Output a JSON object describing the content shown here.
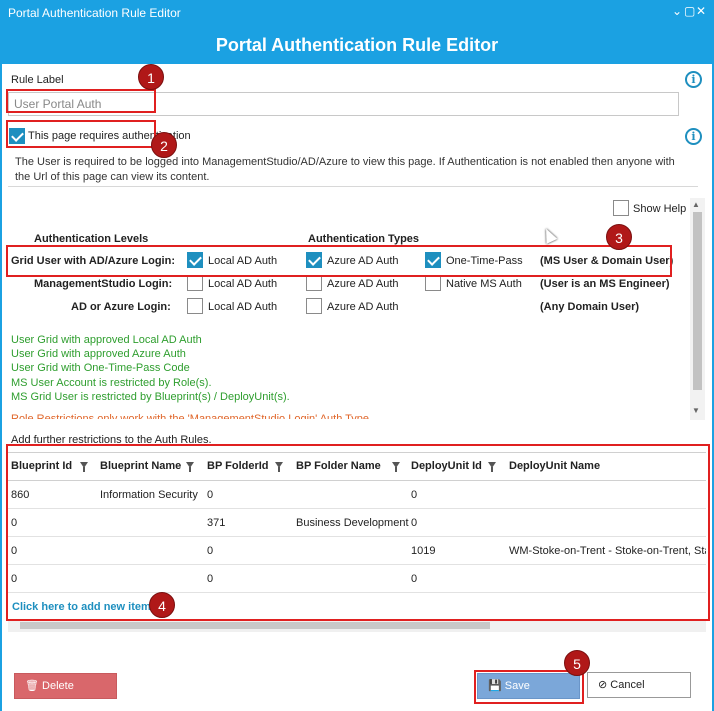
{
  "window": {
    "title": "Portal Authentication Rule Editor",
    "controls": [
      "⌄",
      "▢",
      "✕"
    ]
  },
  "header": {
    "title": "Portal Authentication Rule Editor"
  },
  "rule_label": {
    "label": "Rule Label",
    "value": "User Portal Auth"
  },
  "auth": {
    "checkbox_label": "This page requires authentication",
    "checked": true,
    "description": "The User is required to be logged into ManagementStudio/AD/Azure to view this page. If Authentication is not enabled then anyone with the Url of this page can view its content."
  },
  "show_help": {
    "label": "Show Help",
    "checked": false
  },
  "levels": {
    "heading_levels": "Authentication Levels",
    "heading_types": "Authentication Types",
    "rows": [
      {
        "label": "Grid User with AD/Azure Login:",
        "bold": true,
        "options": [
          {
            "label": "Local AD Auth",
            "checked": true
          },
          {
            "label": "Azure AD Auth",
            "checked": true
          },
          {
            "label": "One-Time-Pass",
            "checked": true
          }
        ],
        "note": "(MS User & Domain User)"
      },
      {
        "label": "ManagementStudio Login:",
        "bold": false,
        "options": [
          {
            "label": "Local AD Auth",
            "checked": false
          },
          {
            "label": "Azure AD Auth",
            "checked": false
          },
          {
            "label": "Native MS Auth",
            "checked": false
          }
        ],
        "note": "(User is an MS Engineer)"
      },
      {
        "label": "AD or Azure Login:",
        "bold": false,
        "options": [
          {
            "label": "Local AD Auth",
            "checked": false
          },
          {
            "label": "Azure AD Auth",
            "checked": false
          }
        ],
        "note": "(Any Domain User)"
      }
    ]
  },
  "summary_lines": [
    "User Grid with approved Local AD Auth",
    "User Grid with approved Azure Auth",
    "User Grid with One-Time-Pass Code",
    "MS User Account is restricted by Role(s).",
    "MS Grid User is restricted by Blueprint(s) / DeployUnit(s)."
  ],
  "warning_line": "Role Restrictions only work with the 'ManagementStudio Login' Auth Type",
  "restrictions": {
    "label": "Add further restrictions to the Auth Rules.",
    "columns": [
      "Blueprint Id",
      "Blueprint Name",
      "BP FolderId",
      "BP Folder Name",
      "DeployUnit Id",
      "DeployUnit Name"
    ],
    "rows": [
      [
        "860",
        "Information Security",
        "0",
        "",
        "0",
        ""
      ],
      [
        "0",
        "",
        "371",
        "Business Development",
        "0",
        ""
      ],
      [
        "0",
        "",
        "0",
        "",
        "1019",
        "WM-Stoke-on-Trent - Stoke-on-Trent, Sta"
      ],
      [
        "0",
        "",
        "0",
        "",
        "0",
        ""
      ]
    ],
    "add_link": "Click here to add new item"
  },
  "buttons": {
    "delete": "Delete",
    "save": "Save",
    "cancel": "Cancel"
  },
  "callouts": [
    "1",
    "2",
    "3",
    "4",
    "5"
  ],
  "colors": {
    "accent": "#1ba1e2",
    "callout": "#e02020",
    "delete": "#d9676b",
    "save": "#7ba7d9",
    "green_text": "#2e9e2e"
  }
}
